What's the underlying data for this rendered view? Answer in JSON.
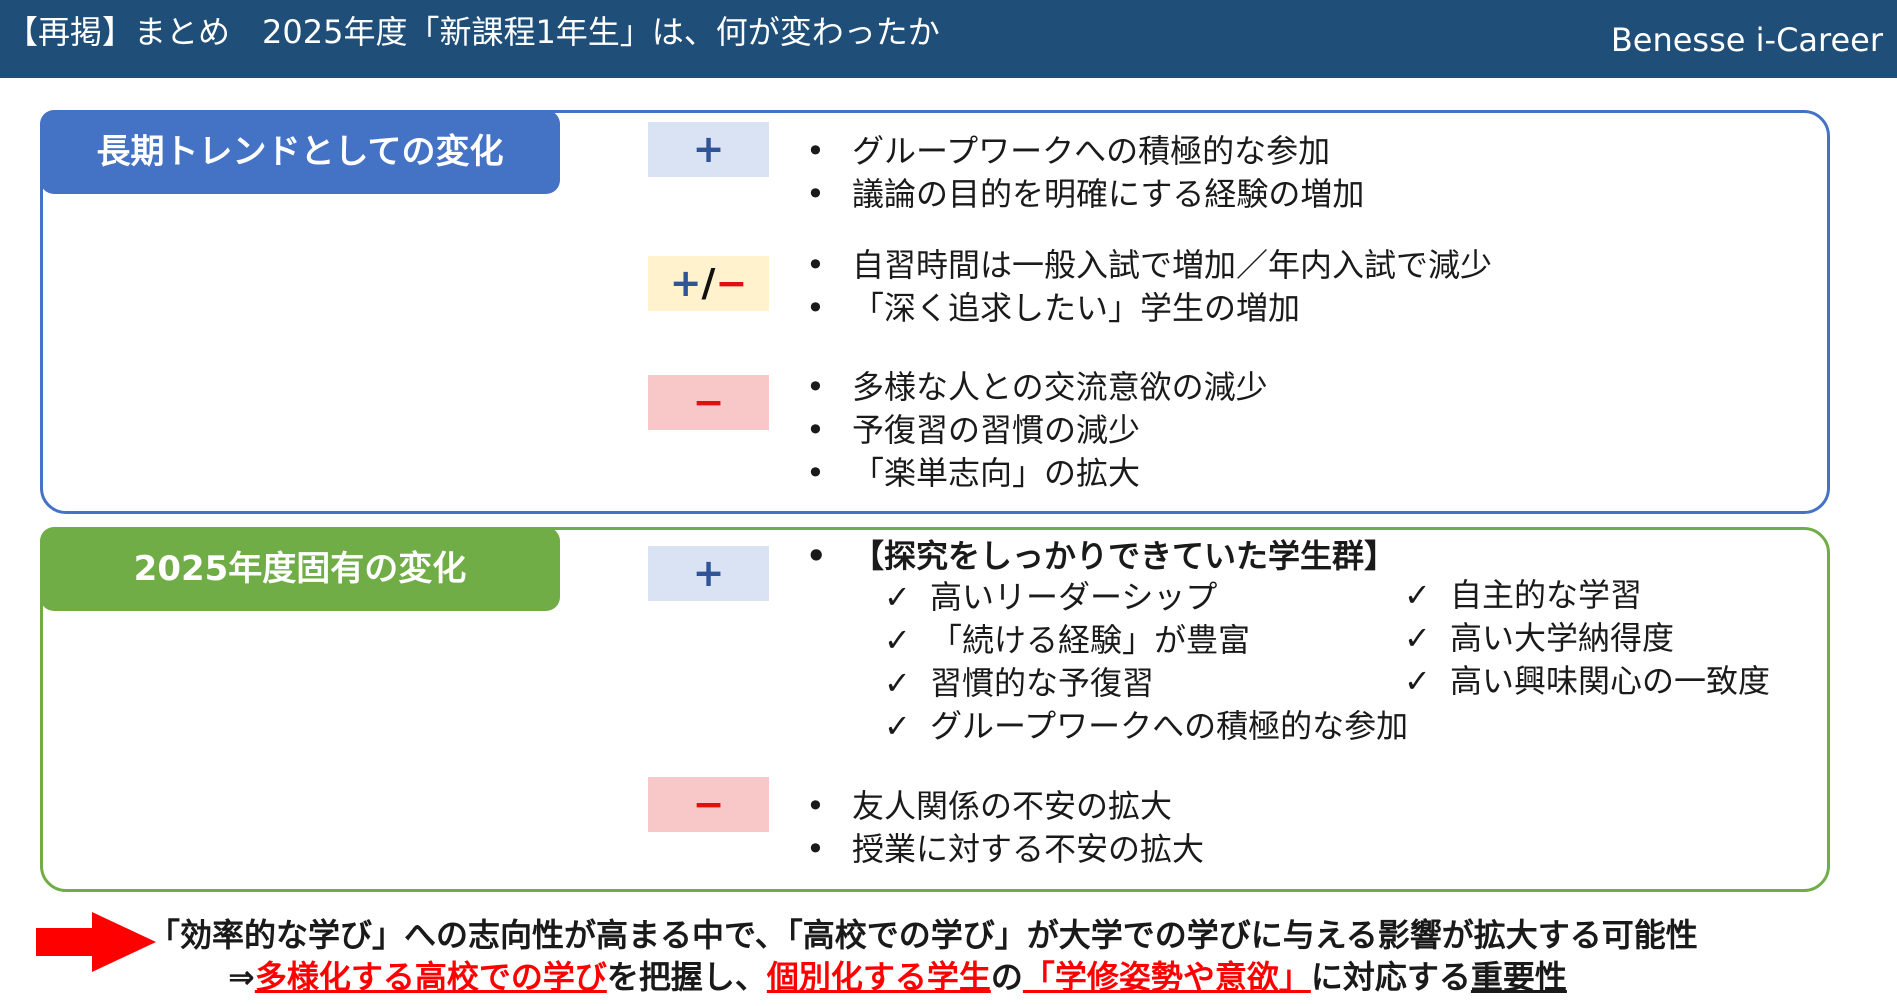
{
  "header": {
    "title": "【再掲】まとめ　2025年度「新課程1年生」は、何が変わったか",
    "brand": "Benesse i-Career"
  },
  "long_term": {
    "label": "長期トレンドとしての変化",
    "plus_sign": "+",
    "plus_items": [
      "グループワークへの積極的な参加",
      "議論の目的を明確にする経験の増加"
    ],
    "mixed_sign": {
      "plus": "+",
      "slash": "/",
      "minus": "−"
    },
    "mixed_items": [
      "自習時間は一般入試で増加／年内入試で減少",
      "「深く追求したい」学生の増加"
    ],
    "minus_sign": "−",
    "minus_items": [
      "多様な人との交流意欲の減少",
      "予復習の習慣の減少",
      "「楽単志向」の拡大"
    ]
  },
  "fy2025": {
    "label": "2025年度固有の変化",
    "plus_sign": "+",
    "plus_heading": "【探究をしっかりできていた学生群】",
    "checks_left": [
      "高いリーダーシップ",
      "「続ける経験」が豊富",
      "習慣的な予復習",
      "グループワークへの積極的な参加"
    ],
    "checks_right": [
      "自主的な学習",
      "高い大学納得度",
      "高い興味関心の一致度"
    ],
    "minus_sign": "−",
    "minus_items": [
      "友人関係の不安の拡大",
      "授業に対する不安の拡大"
    ]
  },
  "conclusion": {
    "line1": "「効率的な学び」への志向性が高まる中で、「高校での学び」が大学での学びに与える影響が拡大する可能性",
    "line2_prefix": "⇒",
    "line2_parts": [
      "多様化する高校での学び",
      "を把握し、",
      "個別化する学生",
      "の",
      "「学修姿勢や意欲」",
      "に対応する",
      "重要性"
    ]
  },
  "colors": {
    "header_bg": "#1f4e79",
    "blue": "#4472c4",
    "green": "#70ad47",
    "plus_bg": "#dae3f3",
    "mixed_bg": "#fff2cc",
    "minus_bg": "#f8c8c8",
    "emphasis_red": "#ff0000"
  },
  "icons": {
    "conclusion_arrow": "right-arrow-icon",
    "check": "checkmark-icon"
  }
}
